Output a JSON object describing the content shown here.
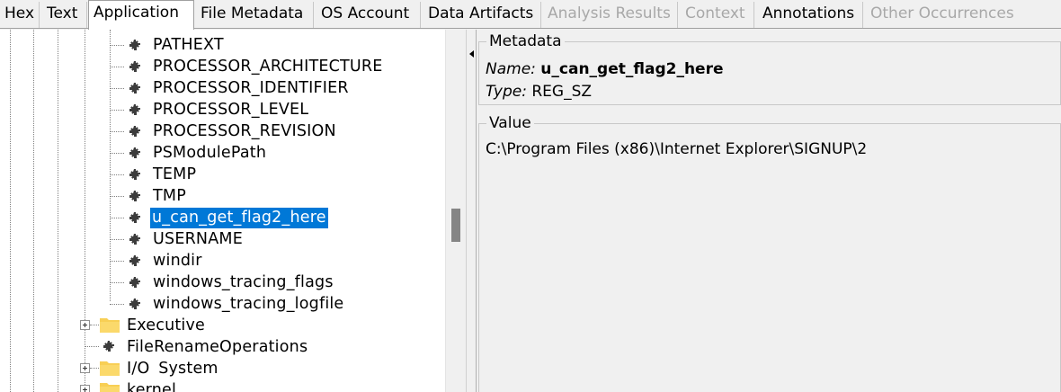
{
  "tabs": [
    {
      "label": "Hex",
      "state": "normal"
    },
    {
      "label": "Text",
      "state": "normal"
    },
    {
      "label": "Application",
      "state": "active"
    },
    {
      "label": "File Metadata",
      "state": "normal"
    },
    {
      "label": "OS Account",
      "state": "normal"
    },
    {
      "label": "Data Artifacts",
      "state": "normal"
    },
    {
      "label": "Analysis Results",
      "state": "disabled"
    },
    {
      "label": "Context",
      "state": "disabled"
    },
    {
      "label": "Annotations",
      "state": "normal"
    },
    {
      "label": "Other Occurrences",
      "state": "disabled"
    }
  ],
  "tree": {
    "values": [
      {
        "label": "PATHEXT",
        "selected": false
      },
      {
        "label": "PROCESSOR_ARCHITECTURE",
        "selected": false
      },
      {
        "label": "PROCESSOR_IDENTIFIER",
        "selected": false
      },
      {
        "label": "PROCESSOR_LEVEL",
        "selected": false
      },
      {
        "label": "PROCESSOR_REVISION",
        "selected": false
      },
      {
        "label": "PSModulePath",
        "selected": false
      },
      {
        "label": "TEMP",
        "selected": false
      },
      {
        "label": "TMP",
        "selected": false
      },
      {
        "label": "u_can_get_flag2_here",
        "selected": true
      },
      {
        "label": "USERNAME",
        "selected": false
      },
      {
        "label": "windir",
        "selected": false
      },
      {
        "label": "windows_tracing_flags",
        "selected": false
      },
      {
        "label": "windows_tracing_logfile",
        "selected": false
      }
    ],
    "keys": [
      {
        "label": "Executive",
        "type": "folder"
      },
      {
        "label": "FileRenameOperations",
        "type": "value"
      },
      {
        "label": "I/O System",
        "type": "folder"
      },
      {
        "label": "kernel",
        "type": "folder"
      }
    ]
  },
  "metadata": {
    "title": "Metadata",
    "name_label": "Name:",
    "name_value": "u_can_get_flag2_here",
    "type_label": "Type:",
    "type_value": "REG_SZ"
  },
  "value": {
    "title": "Value",
    "text": "C:\\Program Files (x86)\\Internet Explorer\\SIGNUP\\2"
  },
  "colors": {
    "selection": "#0078d7",
    "gear": "#3c3c3c",
    "folder": "#f8cf55"
  }
}
